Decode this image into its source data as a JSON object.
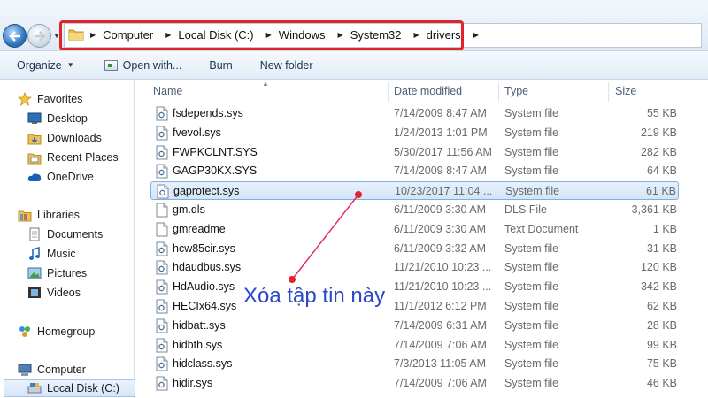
{
  "address_bar": {
    "breadcrumbs": [
      "Computer",
      "Local Disk (C:)",
      "Windows",
      "System32",
      "drivers"
    ]
  },
  "toolbar": {
    "organize_label": "Organize",
    "open_with_label": "Open with...",
    "burn_label": "Burn",
    "new_folder_label": "New folder"
  },
  "nav": {
    "favorites_label": "Favorites",
    "favorites": [
      "Desktop",
      "Downloads",
      "Recent Places",
      "OneDrive"
    ],
    "libraries_label": "Libraries",
    "libraries": [
      "Documents",
      "Music",
      "Pictures",
      "Videos"
    ],
    "homegroup_label": "Homegroup",
    "computer_label": "Computer",
    "local_disk_label": "Local Disk (C:)"
  },
  "columns": {
    "name": "Name",
    "date_modified": "Date modified",
    "type": "Type",
    "size": "Size"
  },
  "files": [
    {
      "name": "fsdepends.sys",
      "date": "7/14/2009 8:47 AM",
      "type": "System file",
      "size": "55 KB"
    },
    {
      "name": "fvevol.sys",
      "date": "1/24/2013 1:01 PM",
      "type": "System file",
      "size": "219 KB"
    },
    {
      "name": "FWPKCLNT.SYS",
      "date": "5/30/2017 11:56 AM",
      "type": "System file",
      "size": "282 KB"
    },
    {
      "name": "GAGP30KX.SYS",
      "date": "7/14/2009 8:47 AM",
      "type": "System file",
      "size": "64 KB"
    },
    {
      "name": "gaprotect.sys",
      "date": "10/23/2017 11:04 ...",
      "type": "System file",
      "size": "61 KB"
    },
    {
      "name": "gm.dls",
      "date": "6/11/2009 3:30 AM",
      "type": "DLS File",
      "size": "3,361 KB"
    },
    {
      "name": "gmreadme",
      "date": "6/11/2009 3:30 AM",
      "type": "Text Document",
      "size": "1 KB"
    },
    {
      "name": "hcw85cir.sys",
      "date": "6/11/2009 3:32 AM",
      "type": "System file",
      "size": "31 KB"
    },
    {
      "name": "hdaudbus.sys",
      "date": "11/21/2010 10:23 ...",
      "type": "System file",
      "size": "120 KB"
    },
    {
      "name": "HdAudio.sys",
      "date": "11/21/2010 10:23 ...",
      "type": "System file",
      "size": "342 KB"
    },
    {
      "name": "HECIx64.sys",
      "date": "11/1/2012 6:12 PM",
      "type": "System file",
      "size": "62 KB"
    },
    {
      "name": "hidbatt.sys",
      "date": "7/14/2009 6:31 AM",
      "type": "System file",
      "size": "28 KB"
    },
    {
      "name": "hidbth.sys",
      "date": "7/14/2009 7:06 AM",
      "type": "System file",
      "size": "99 KB"
    },
    {
      "name": "hidclass.sys",
      "date": "7/3/2013 11:05 AM",
      "type": "System file",
      "size": "75 KB"
    },
    {
      "name": "hidir.sys",
      "date": "7/14/2009 7:06 AM",
      "type": "System file",
      "size": "46 KB"
    }
  ],
  "annotation": {
    "text": "Xóa tập tin này",
    "highlight_color": "#e0242c",
    "text_color": "#2b49c9"
  }
}
